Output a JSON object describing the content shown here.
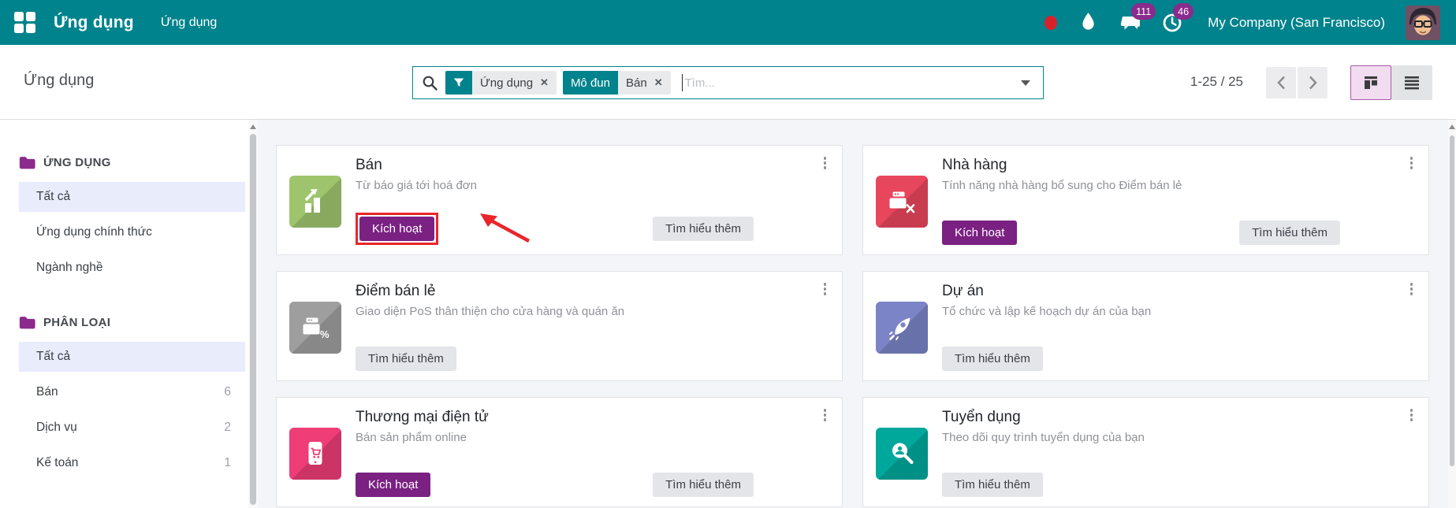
{
  "topbar": {
    "app_title": "Ứng dụng",
    "menu_item": "Ứng dụng",
    "notifications": {
      "messages": "111",
      "activities": "46"
    },
    "company": "My Company (San Francisco)"
  },
  "control_panel": {
    "breadcrumb": "Ứng dụng",
    "search": {
      "facets": [
        {
          "label": "",
          "value": "Ứng dụng"
        },
        {
          "label": "Mô đun",
          "value": "Bán"
        }
      ],
      "remove_icon": "✕",
      "placeholder": "Tìm..."
    },
    "pager": {
      "range": "1-25 / 25"
    }
  },
  "sidebar": {
    "sections": [
      {
        "title": "ỨNG DỤNG",
        "items": [
          {
            "label": "Tất cả",
            "active": true
          },
          {
            "label": "Ứng dụng chính thức",
            "active": false
          },
          {
            "label": "Ngành nghề",
            "active": false
          }
        ]
      },
      {
        "title": "PHÂN LOẠI",
        "items": [
          {
            "label": "Tất cả",
            "active": true
          },
          {
            "label": "Bán",
            "count": "6",
            "active": false
          },
          {
            "label": "Dịch vụ",
            "count": "2",
            "active": false
          },
          {
            "label": "Kế toán",
            "count": "1",
            "active": false
          }
        ]
      }
    ]
  },
  "cards": [
    {
      "title": "Bán",
      "subtitle": "Từ báo giá tới hoá đơn",
      "activate_label": "Kích hoạt",
      "learn_more_label": "Tìm hiểu thêm",
      "icon": "sales-icon",
      "color": "#9ec56d",
      "annotated": true
    },
    {
      "title": "Nhà hàng",
      "subtitle": "Tính năng nhà hàng bổ sung cho Điểm bán lẻ",
      "activate_label": "Kích hoạt",
      "learn_more_label": "Tìm hiểu thêm",
      "icon": "restaurant-icon",
      "color": "#e8465c",
      "annotated": false
    },
    {
      "title": "Điểm bán lẻ",
      "subtitle": "Giao diện PoS thân thiện cho cửa hàng và quán ăn",
      "learn_more_label": "Tìm hiểu thêm",
      "icon": "pos-icon",
      "color": "#9e9e9e",
      "annotated": false
    },
    {
      "title": "Dự án",
      "subtitle": "Tổ chức và lập kế hoạch dự án của bạn",
      "learn_more_label": "Tìm hiểu thêm",
      "icon": "project-icon",
      "color": "#7a84c6",
      "annotated": false
    },
    {
      "title": "Thương mại điện tử",
      "subtitle": "Bán sản phẩm online",
      "activate_label": "Kích hoạt",
      "learn_more_label": "Tìm hiểu thêm",
      "icon": "ecommerce-icon",
      "color": "#ee3d77",
      "annotated": false
    },
    {
      "title": "Tuyển dụng",
      "subtitle": "Theo dõi quy trình tuyển dụng của bạn",
      "learn_more_label": "Tìm hiểu thêm",
      "icon": "recruitment-icon",
      "color": "#00a79b",
      "annotated": false
    }
  ],
  "colors": {
    "topbar_teal": "#00838c",
    "badge_purple": "#8a2b8d",
    "activate_purple": "#7a2182",
    "annotation_red": "#e8262c",
    "sidebar_active": "#e8ecfb"
  }
}
